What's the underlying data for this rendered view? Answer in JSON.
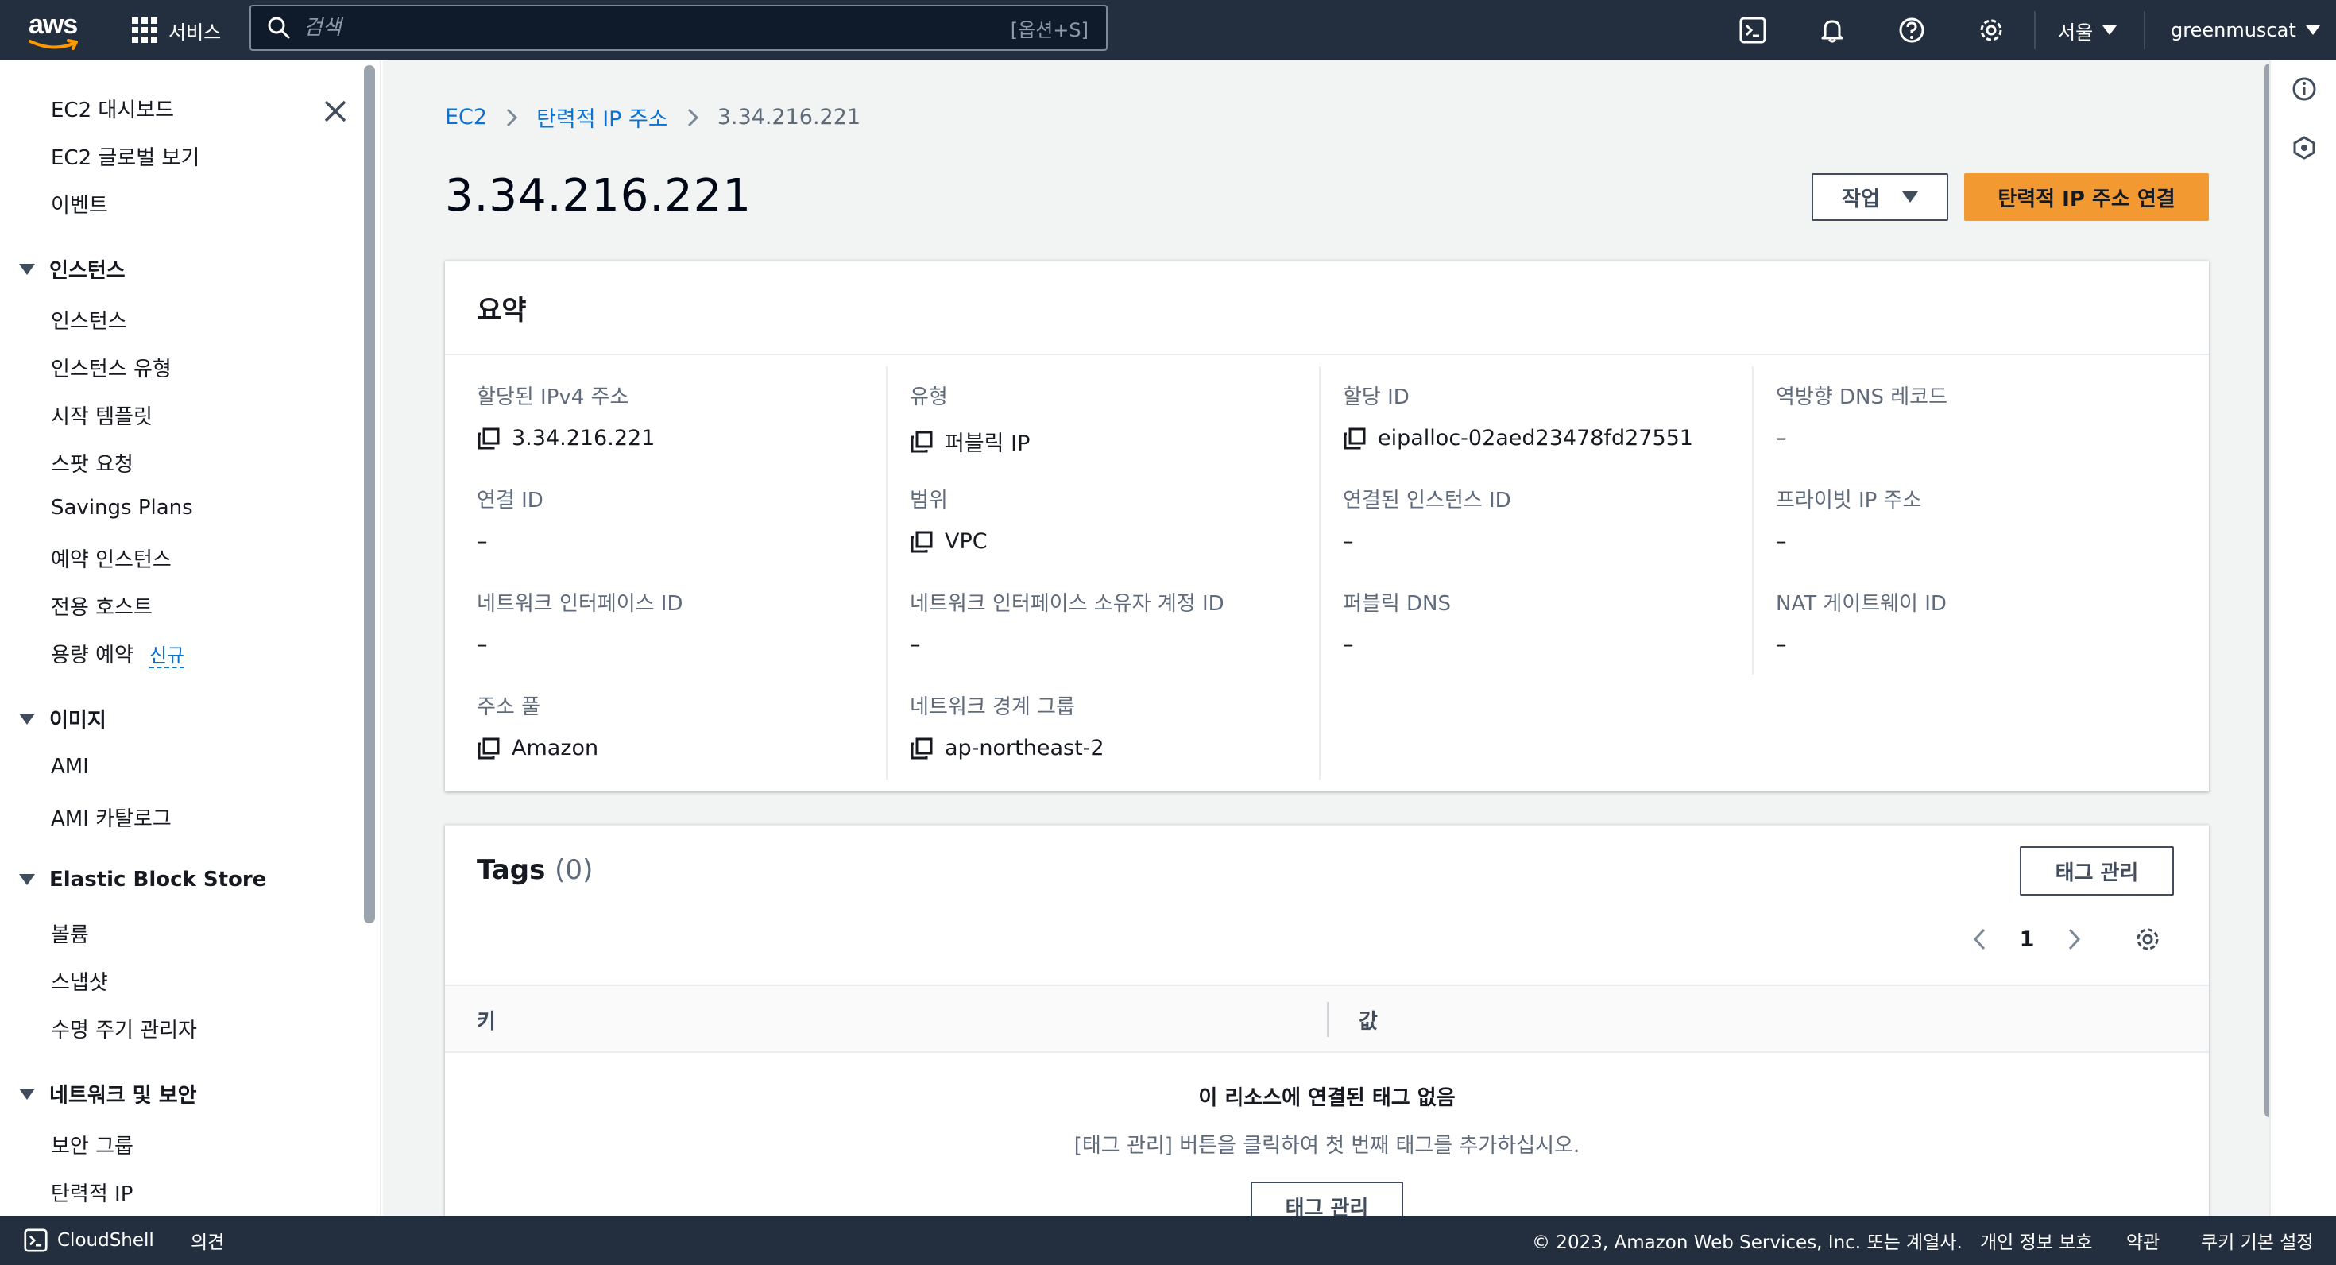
{
  "topnav": {
    "logo_text": "aws",
    "services_label": "서비스",
    "search_placeholder": "검색",
    "search_shortcut": "[옵션+S]",
    "region": "서울",
    "account": "greenmuscat",
    "icons": [
      "cloudshell-icon",
      "bell-icon",
      "help-icon",
      "gear-icon"
    ]
  },
  "sidebar": {
    "top_links": [
      "EC2 대시보드",
      "EC2 글로벌 보기",
      "이벤트"
    ],
    "sections": [
      {
        "title": "인스턴스",
        "items": [
          "인스턴스",
          "인스턴스 유형",
          "시작 템플릿",
          "스팟 요청",
          "Savings Plans",
          "예약 인스턴스",
          "전용 호스트",
          "용량 예약"
        ]
      },
      {
        "title": "이미지",
        "items": [
          "AMI",
          "AMI 카탈로그"
        ]
      },
      {
        "title": "Elastic Block Store",
        "items": [
          "볼륨",
          "스냅샷",
          "수명 주기 관리자"
        ]
      },
      {
        "title": "네트워크 및 보안",
        "items": [
          "보안 그룹",
          "탄력적 IP"
        ]
      }
    ],
    "new_badge": "신규"
  },
  "breadcrumb": [
    "EC2",
    "탄력적 IP 주소",
    "3.34.216.221"
  ],
  "page": {
    "title": "3.34.216.221",
    "actions_label": "작업",
    "primary_label": "탄력적 IP 주소 연결"
  },
  "summary": {
    "heading": "요약",
    "columns": [
      [
        {
          "label": "할당된 IPv4 주소",
          "value": "3.34.216.221",
          "copy": true
        },
        {
          "label": "연결 ID",
          "value": "–",
          "copy": false
        },
        {
          "label": "네트워크 인터페이스 ID",
          "value": "–",
          "copy": false
        },
        {
          "label": "주소 풀",
          "value": "Amazon",
          "copy": true
        }
      ],
      [
        {
          "label": "유형",
          "value": "퍼블릭 IP",
          "copy": true
        },
        {
          "label": "범위",
          "value": "VPC",
          "copy": true
        },
        {
          "label": "네트워크 인터페이스 소유자 계정 ID",
          "value": "–",
          "copy": false
        },
        {
          "label": "네트워크 경계 그룹",
          "value": "ap-northeast-2",
          "copy": true
        }
      ],
      [
        {
          "label": "할당 ID",
          "value": "eipalloc-02aed23478fd27551",
          "copy": true
        },
        {
          "label": "연결된 인스턴스 ID",
          "value": "–",
          "copy": false
        },
        {
          "label": "퍼블릭 DNS",
          "value": "–",
          "copy": false
        }
      ],
      [
        {
          "label": "역방향 DNS 레코드",
          "value": "–",
          "copy": false
        },
        {
          "label": "프라이빗 IP 주소",
          "value": "–",
          "copy": false
        },
        {
          "label": "NAT 게이트웨이 ID",
          "value": "–",
          "copy": false
        }
      ]
    ]
  },
  "tags": {
    "title": "Tags",
    "count": "(0)",
    "manage_label": "태그 관리",
    "page_number": "1",
    "col_key": "키",
    "col_value": "값",
    "empty_title": "이 리소스에 연결된 태그 없음",
    "empty_desc": "[태그 관리] 버튼을 클릭하여 첫 번째 태그를 추가하십시오.",
    "empty_button": "태그 관리"
  },
  "footer": {
    "cloudshell": "CloudShell",
    "feedback": "의견",
    "copyright": "© 2023, Amazon Web Services, Inc. 또는 계열사.",
    "privacy": "개인 정보 보호",
    "terms": "약관",
    "cookies": "쿠키 기본 설정"
  }
}
